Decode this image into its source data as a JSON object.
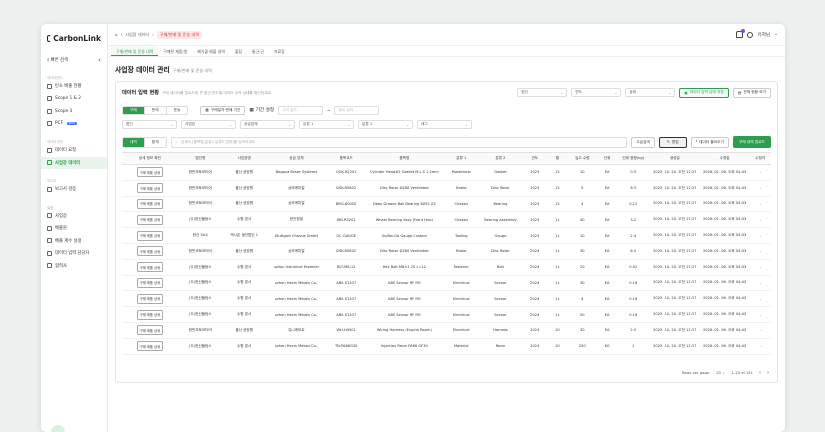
{
  "app": {
    "logo": "CarbonLink"
  },
  "sidebar": {
    "search_label": "빠른 검색",
    "sections": [
      {
        "title": "데이터관리",
        "items": [
          {
            "label": "탄소 배출 현황"
          },
          {
            "label": "Scope 1 & 2"
          },
          {
            "label": "Scope 3"
          },
          {
            "label": "PCF",
            "badge": "BETA"
          }
        ]
      },
      {
        "title": "데이터 관리",
        "items": [
          {
            "label": "데이터 요청"
          },
          {
            "label": "사업장 데이터",
            "active": true
          }
        ]
      },
      {
        "title": "보고서",
        "items": [
          {
            "label": "보고서 검증"
          }
        ]
      },
      {
        "title": "설정",
        "items": [
          {
            "label": "사업장"
          },
          {
            "label": "배출원"
          },
          {
            "label": "배출 계수 설정"
          },
          {
            "label": "데이터 입력 담당자"
          },
          {
            "label": "협력사"
          }
        ]
      }
    ]
  },
  "header": {
    "breadcrumb": [
      "사업장 데이터",
      "구매/판매 및 운송 내역"
    ],
    "user": "유저님"
  },
  "tabs": [
    {
      "label": "구매/판매 및 운송 내역",
      "active": true
    },
    {
      "label": "구매한 제품/원"
    },
    {
      "label": "폐기물 배출 내역"
    },
    {
      "label": "출장"
    },
    {
      "label": "통근/근"
    },
    {
      "label": "자료등"
    }
  ],
  "page": {
    "title": "사업장 데이터 관리",
    "subtitle": "구매/판매 및 운송 내역"
  },
  "panel": {
    "status_title": "데이터 입력 현황",
    "status_desc": "구매 데이터를 업로드한 후 법인·연도별 데이터 입력 상태를 확인하세요.",
    "selects": [
      {
        "label": "법인"
      },
      {
        "label": "연도"
      },
      {
        "label": "상태"
      }
    ],
    "status_button": "데이터 입력 상태 저장",
    "overview_button": "전체 현황 보기",
    "mode_tabs": [
      {
        "label": "구매",
        "on": true
      },
      {
        "label": "판매",
        "on": false
      },
      {
        "label": "운송",
        "on": false
      }
    ],
    "period_label": "구매일자·판매 기간",
    "period_toggle": "기간 설정",
    "date_from_ph": "시작 일자",
    "date_to_ph": "종료 일자",
    "filters": [
      {
        "label": "법인"
      },
      {
        "label": "사업장"
      },
      {
        "label": "공급업체"
      },
      {
        "label": "분류 1"
      },
      {
        "label": "분류 2"
      },
      {
        "label": "태그"
      }
    ],
    "view_tabs": [
      {
        "label": "내역",
        "on": true
      },
      {
        "label": "합계",
        "on": false
      }
    ],
    "search_ph": "검색어 (품목명,분류1,분류2,업체)를 검색하세요",
    "adv_search": "고급검색",
    "edit_button": "편집",
    "download_button": "데이터 불러오기",
    "upload_button": "구매 내역 업로드"
  },
  "table": {
    "columns": [
      "상세 정보 확인",
      "법인명",
      "사업장명",
      "공급 업체",
      "품목코드",
      "품목명",
      "분류 1",
      "분류 2",
      "연도",
      "월",
      "입고 수량",
      "단위",
      "단위 중량(kg)",
      "생성일",
      "수정일",
      "수정자"
    ],
    "detail_label": "구매 제품 상세",
    "rows": [
      [
        "한민모토모터어",
        "울산 공장원",
        "Nagoya Brake Systems",
        "OGK-H2201",
        "Cylinder Head#2 Gasket M.L.S 1.2mm",
        "Powertrain",
        "Gasket",
        "2025",
        "12",
        "10",
        "EA",
        "0.5",
        "2025. 10. 20. 오전 12:27",
        "2026. 01. 06. 오후 04:43",
        "-"
      ],
      [
        "한민모토모터어",
        "울산 공장원",
        "삼보케미칼",
        "DSK-R5802",
        "Disc Rotor Ø280 Ventilated",
        "Brake",
        "Disc Rotor",
        "2024",
        "12",
        "5",
        "EA",
        "6.5",
        "2025. 10. 20. 오전 12:27",
        "2026. 01. 06. 오후 04:43",
        "-"
      ],
      [
        "한민모토모터어",
        "울산 공장원",
        "삼보케미칼",
        "BRG-6005Z",
        "Deep Groove Ball Bearing 6005 ZZ",
        "Chassis",
        "Bearing",
        "2024",
        "12",
        "4",
        "EA",
        "0.12",
        "2025. 10. 20. 오전 12:27",
        "2026. 01. 06. 오후 04:43",
        "-"
      ],
      [
        "(주)한신물팀스",
        "수원 본사",
        "한진정밀",
        "WB-R3201",
        "Wheel Bearing Assy (Front Hub)",
        "Chassis",
        "Bearing Assembly",
        "2024",
        "11",
        "40",
        "EA",
        "3.2",
        "2025. 10. 20. 오전 12:27",
        "2026. 01. 06. 오후 04:43",
        "-"
      ],
      [
        "한신 S&S",
        "액시온 생산법인 1",
        "Stuttgart Chassis GmbH",
        "GC-GAUGE",
        "Go/No-Go Gauge Custom",
        "Tooling",
        "Gauge",
        "2024",
        "11",
        "10",
        "EA",
        "2.4",
        "2025. 10. 20. 오전 12:27",
        "2026. 01. 06. 오후 04:43",
        "-"
      ],
      [
        "한민모토모터어",
        "울산 공장원",
        "삼보케미칼",
        "DSK-R5802",
        "Disc Rotor Ø280 Ventilated",
        "Brake",
        "Disc Rotor",
        "2024",
        "11",
        "30",
        "EA",
        "6.5",
        "2025. 10. 20. 오전 12:27",
        "2026. 01. 06. 오후 04:43",
        "-"
      ],
      [
        "(주)한신물팀스",
        "수원 본사",
        "uzhou Industrial Fastener",
        "BLT-M8-12",
        "Hex Bolt M8×1.25 L=12",
        "Fastener",
        "Bolt",
        "2024",
        "11",
        "20",
        "EA",
        "0.02",
        "2025. 10. 20. 오전 12:27",
        "2026. 01. 06. 오후 04:43",
        "-"
      ],
      [
        "(주)한신물팀스",
        "수원 본사",
        "nzhen Hexin Metals Co.,",
        "ABS-S1207",
        "ABS Sensor RF RH",
        "Electrical",
        "Sensor",
        "2024",
        "11",
        "30",
        "EA",
        "0.18",
        "2025. 10. 20. 오전 12:27",
        "2026. 01. 06. 오후 04:43",
        "-"
      ],
      [
        "(주)한신물팀스",
        "수원 본사",
        "nzhen Hexin Metals Co.,",
        "ABS-S1207",
        "ABS Sensor RF RH",
        "Electrical",
        "Sensor",
        "2024",
        "11",
        "4",
        "EA",
        "0.18",
        "2025. 10. 20. 오전 12:27",
        "2026. 01. 06. 오후 04:43",
        "-"
      ],
      [
        "(주)한신물팀스",
        "수원 본사",
        "nzhen Hexin Metals Co.,",
        "ABS-S1207",
        "ABS Sensor RF RH",
        "Electrical",
        "Sensor",
        "2024",
        "11",
        "50",
        "EA",
        "0.18",
        "2025. 10. 20. 오전 12:27",
        "2026. 01. 06. 오후 04:43",
        "-"
      ],
      [
        "한민모토모터어",
        "울산 공장원",
        "유니케모트",
        "WH-H4501",
        "Wiring Harness (Engine Room)",
        "Electrical",
        "Harness",
        "2024",
        "10",
        "30",
        "EA",
        "2.5",
        "2025. 10. 20. 오전 12:27",
        "2026. 01. 06. 오후 04:43",
        "-"
      ],
      [
        "(주)한신물팀스",
        "수원 본사",
        "nzhen Hexin Metals Co.,",
        "TN-PA66G30",
        "Injection Resin PA66 GF30",
        "Material",
        "Resin",
        "2024",
        "10",
        "250",
        "KG",
        "1",
        "2025. 10. 20. 오전 12:27",
        "2026. 01. 06. 오후 04:43",
        "-"
      ]
    ]
  },
  "pagination": {
    "rows_label": "Rows per page:",
    "rows_value": "20",
    "range": "1–20 of 141"
  }
}
